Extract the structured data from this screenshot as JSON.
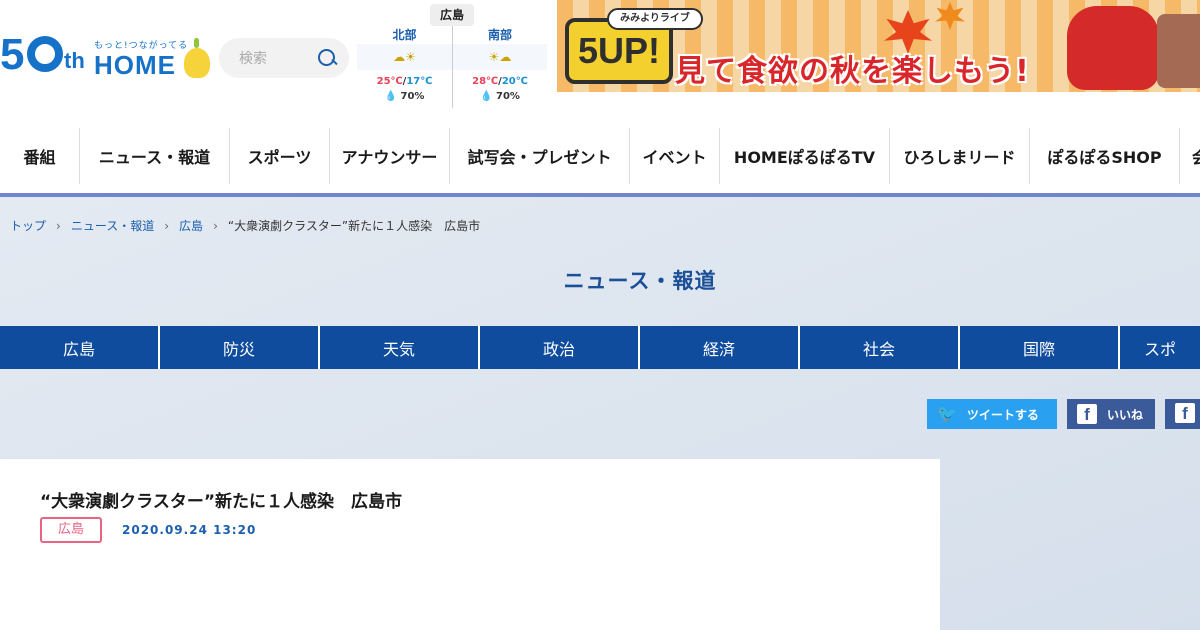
{
  "header": {
    "logo": {
      "fifty": "5",
      "th": "th",
      "tagline": "もっと!つながってる",
      "home": "HOME"
    },
    "search": {
      "placeholder": "検索"
    },
    "weather": {
      "region": "広島",
      "north": {
        "name": "北部",
        "icon": "cloudy-sunny-icon",
        "hi": "25℃",
        "lo": "17℃",
        "rain": "70%"
      },
      "south": {
        "name": "南部",
        "icon": "sunny-cloudy-icon",
        "hi": "28℃",
        "lo": "20℃",
        "rain": "70%"
      }
    },
    "banner": {
      "badge": "5UP!",
      "pill": "みみよりライブ",
      "catch": "見て食欲の秋を楽しもう!"
    }
  },
  "gnav": [
    "番組",
    "ニュース・報道",
    "スポーツ",
    "アナウンサー",
    "試写会・プレゼント",
    "イベント",
    "HOMEぽるぽるTV",
    "ひろしまリード",
    "ぽるぽるSHOP",
    "会"
  ],
  "breadcrumb": {
    "top": "トップ",
    "news": "ニュース・報道",
    "hiroshima": "広島",
    "current": "“大衆演劇クラスター”新たに１人感染　広島市"
  },
  "page_title": "ニュース・報道",
  "subnav": [
    "広島",
    "防災",
    "天気",
    "政治",
    "経済",
    "社会",
    "国際",
    "スポ"
  ],
  "share": {
    "tweet": "ツイートする",
    "like": "いいね"
  },
  "article": {
    "title": "“大衆演劇クラスター”新たに１人感染　広島市",
    "category": "広島",
    "date": "2020.09.24 13:20"
  },
  "colors": {
    "primary": "#0f4c9e",
    "accent_band": "#6f86cf",
    "category_pink": "#e96482",
    "twitter": "#29a1f0",
    "facebook": "#3b5a9a"
  }
}
